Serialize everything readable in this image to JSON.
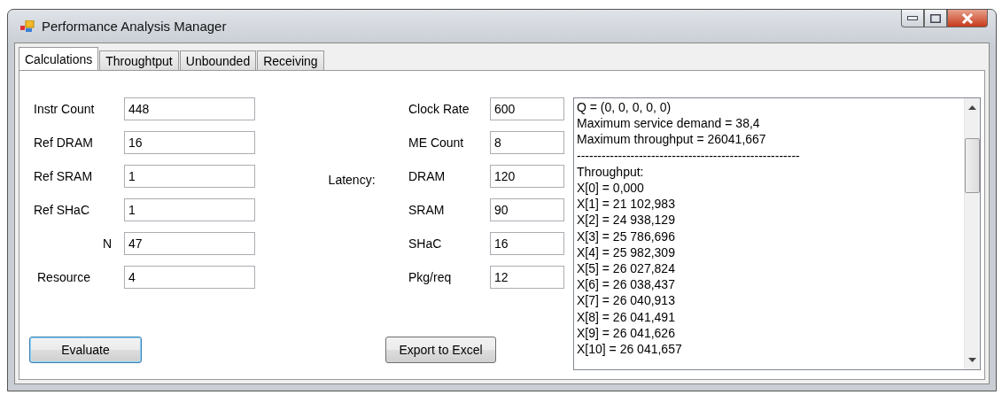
{
  "window": {
    "title": "Performance Analysis Manager"
  },
  "tabs": [
    {
      "label": "Calculations",
      "selected": true
    },
    {
      "label": "Throughtput",
      "selected": false
    },
    {
      "label": "Unbounded",
      "selected": false
    },
    {
      "label": "Receiving",
      "selected": false
    }
  ],
  "left_fields": [
    {
      "label": "Instr Count",
      "value": "448",
      "kind": "plain"
    },
    {
      "label": "Ref DRAM",
      "value": "16",
      "kind": "plain"
    },
    {
      "label": "Ref SRAM",
      "value": "1",
      "kind": "plain"
    },
    {
      "label": "Ref SHaC",
      "value": "1",
      "kind": "plain"
    },
    {
      "label": "N",
      "value": "47",
      "kind": "right"
    },
    {
      "label": "Resource",
      "value": "4",
      "kind": "indent"
    }
  ],
  "latency_label": "Latency:",
  "right_fields": [
    {
      "label": "Clock Rate",
      "value": "600"
    },
    {
      "label": "ME Count",
      "value": "8"
    },
    {
      "label": "DRAM",
      "value": "120"
    },
    {
      "label": "SRAM",
      "value": "90"
    },
    {
      "label": "SHaC",
      "value": "16"
    },
    {
      "label": "Pkg/req",
      "value": "12"
    }
  ],
  "buttons": [
    {
      "label": "Evaluate",
      "focused": true
    },
    {
      "label": "Export to Excel",
      "focused": false
    }
  ],
  "output_lines": [
    "Q = (0, 0, 0, 0, 0)",
    "Maximum service demand = 38,4",
    "Maximum throughput = 26041,667",
    "------------------------------------------------------",
    "Throughput:",
    "X[0] = 0,000",
    "X[1] = 21 102,983",
    "X[2] = 24 938,129",
    "X[3] = 25 786,696",
    "X[4] = 25 982,309",
    "X[5] = 26 027,824",
    "X[6] = 26 038,437",
    "X[7] = 26 040,913",
    "X[8] = 26 041,491",
    "X[9] = 26 041,626",
    "X[10] = 26 041,657"
  ]
}
